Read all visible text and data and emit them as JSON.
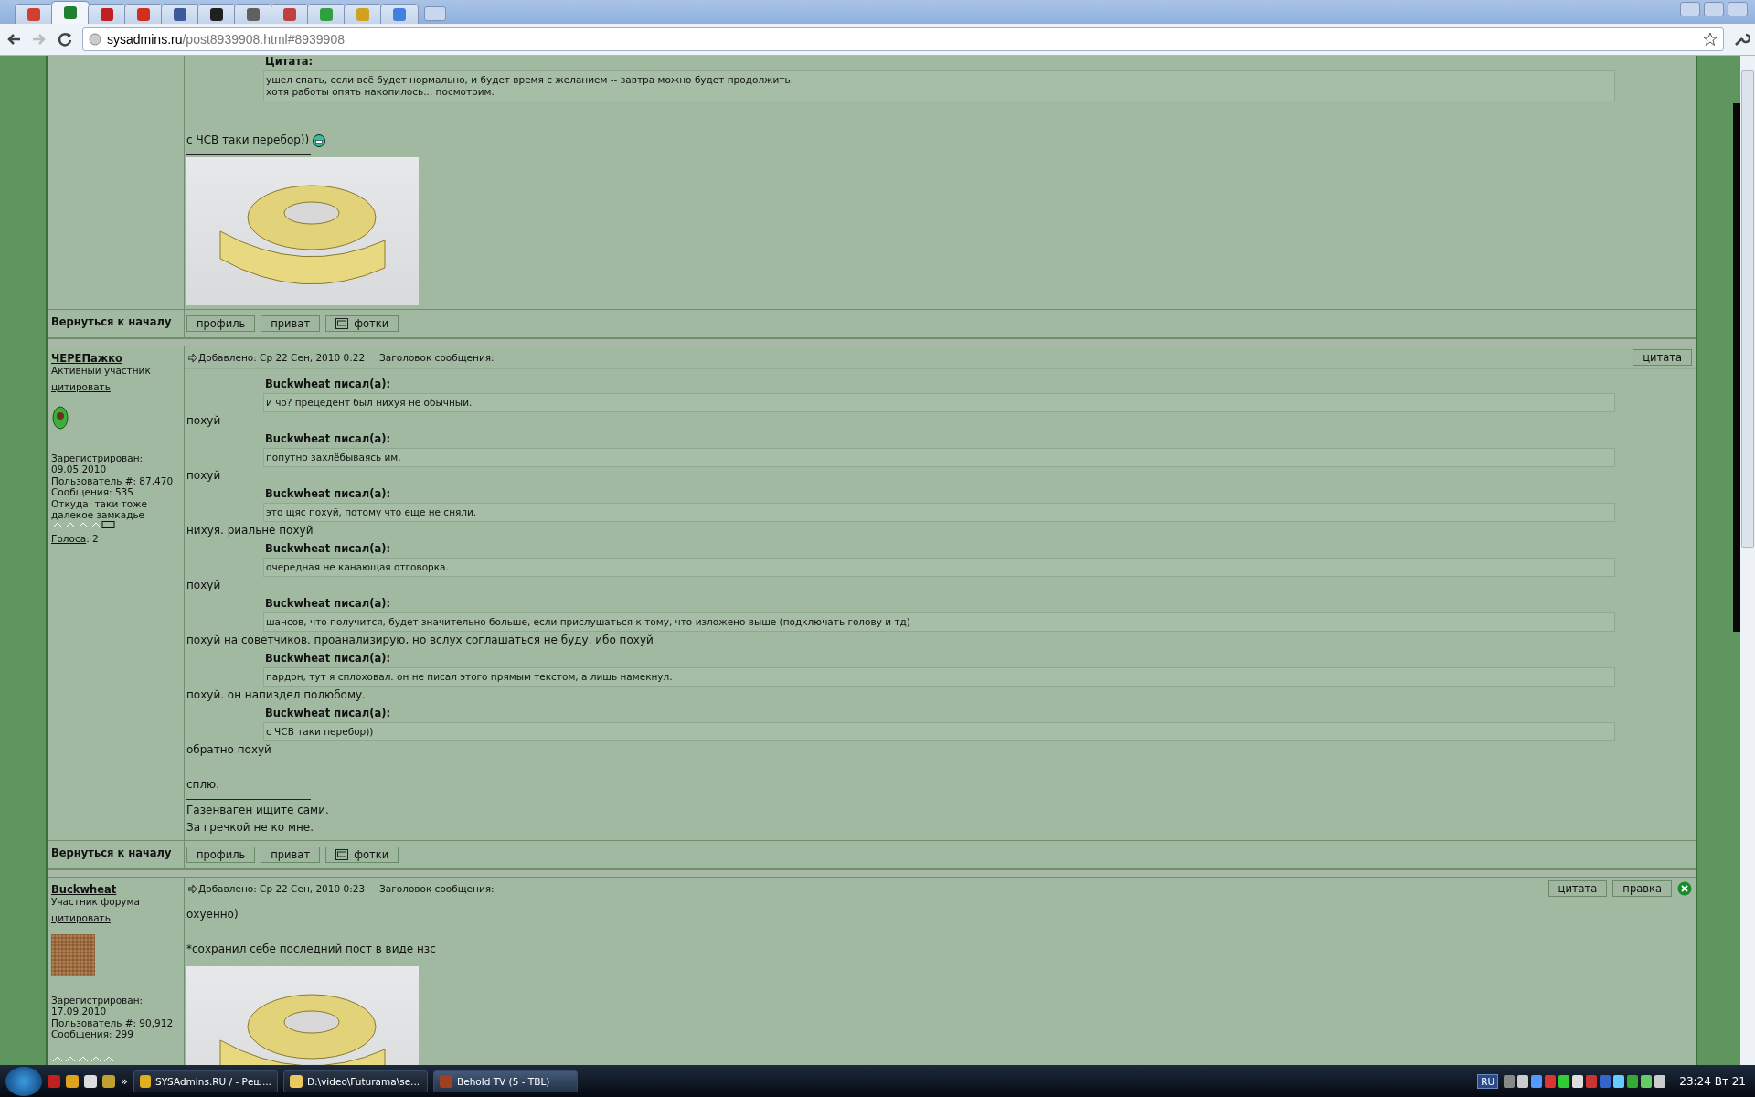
{
  "browser": {
    "tabs": [
      {
        "selected": false,
        "color": "#d04030"
      },
      {
        "selected": true,
        "color": "#208030"
      },
      {
        "selected": false,
        "color": "#c02020"
      },
      {
        "selected": false,
        "color": "#d03020"
      },
      {
        "selected": false,
        "color": "#3a5a9a"
      },
      {
        "selected": false,
        "color": "#202020"
      },
      {
        "selected": false,
        "color": "#606060"
      },
      {
        "selected": false,
        "color": "#c04040"
      },
      {
        "selected": false,
        "color": "#30a040"
      },
      {
        "selected": false,
        "color": "#d0a020"
      },
      {
        "selected": false,
        "color": "#4080e0"
      }
    ],
    "address": {
      "domain": "sysadmins.ru",
      "path": "/post8939908.html#8939908"
    }
  },
  "posts": [
    {
      "body": [
        {
          "kind": "quote",
          "header": "Цитата:",
          "lines": [
            "ушел спать, если всё будет нормально, и будет время с желанием -- завтра можно будет продолжить.",
            "хотя работы опять накопилось... посмотрим."
          ]
        },
        {
          "kind": "gap"
        },
        {
          "kind": "text",
          "text": "с ЧСВ таки перебор))",
          "smiley": true
        },
        {
          "kind": "signature_image"
        }
      ],
      "footer": {
        "back": "Вернуться к началу",
        "buttons": [
          "профиль",
          "приват",
          "фотки"
        ]
      }
    },
    {
      "author": {
        "name": "ЧЕРЕПажко",
        "rank": "Активный участник",
        "quote_link": "цитировать",
        "avatar": {
          "kind": "creature"
        },
        "stats": [
          "Зарегистрирован:",
          "09.05.2010",
          "Пользователь #: 87,470",
          "Сообщения: 535",
          "Откуда: таки тоже далекое замкадье"
        ],
        "votes_link": "Голоса",
        "votes": ": 2"
      },
      "posted": "Добавлено: Ср 22 Сен, 2010 0:22",
      "subject": "Заголовок сообщения:",
      "actions": [
        "цитата"
      ],
      "can_delete": false,
      "body": [
        {
          "kind": "quote",
          "header": "Buckwheat писал(а):",
          "lines": [
            "и чо? прецедент был нихуя не обычный."
          ]
        },
        {
          "kind": "text",
          "text": "похуй"
        },
        {
          "kind": "quote",
          "header": "Buckwheat писал(а):",
          "lines": [
            "попутно захлёбываясь им."
          ]
        },
        {
          "kind": "text",
          "text": "похуй"
        },
        {
          "kind": "quote",
          "header": "Buckwheat писал(а):",
          "lines": [
            "это щяс похуй, потому что еще не сняли."
          ]
        },
        {
          "kind": "text",
          "text": "нихуя. риальне похуй"
        },
        {
          "kind": "quote",
          "header": "Buckwheat писал(а):",
          "lines": [
            "очередная не канающая отговорка."
          ]
        },
        {
          "kind": "text",
          "text": "похуй"
        },
        {
          "kind": "quote",
          "header": "Buckwheat писал(а):",
          "lines": [
            "шансов, что получится, будет значительно больше, если прислушаться к тому, что изложено выше (подключать голову и тд)"
          ]
        },
        {
          "kind": "text",
          "text": "похуй на советчиков. проанализирую, но вслух соглашаться не буду. ибо похуй"
        },
        {
          "kind": "quote",
          "header": "Buckwheat писал(а):",
          "lines": [
            "пардон, тут я сплоховал. он не писал этого прямым текстом, а лишь намекнул."
          ]
        },
        {
          "kind": "text",
          "text": "похуй. он напиздел полюбому."
        },
        {
          "kind": "quote",
          "header": "Buckwheat писал(а):",
          "lines": [
            "с ЧСВ таки перебор))"
          ]
        },
        {
          "kind": "text",
          "text": "обратно похуй"
        },
        {
          "kind": "gap"
        },
        {
          "kind": "text",
          "text": "сплю."
        },
        {
          "kind": "signature_text",
          "lines": [
            "Газенваген ищите сами.",
            "За гречкой не ко мне."
          ]
        }
      ],
      "footer": {
        "back": "Вернуться к началу",
        "buttons": [
          "профиль",
          "приват",
          "фотки"
        ]
      }
    },
    {
      "author": {
        "name": "Buckwheat",
        "rank": "Участник форума",
        "quote_link": "цитировать",
        "avatar": {
          "kind": "buckwheat"
        },
        "stats": [
          "Зарегистрирован:",
          "17.09.2010",
          "Пользователь #: 90,912",
          "Сообщения: 299"
        ]
      },
      "posted": "Добавлено: Ср 22 Сен, 2010 0:23",
      "subject": "Заголовок сообщения:",
      "actions": [
        "цитата",
        "правка"
      ],
      "can_delete": true,
      "body": [
        {
          "kind": "text",
          "text": "охуенно)"
        },
        {
          "kind": "gap"
        },
        {
          "kind": "text",
          "text": "*сохранил себе последний пост в виде нзс"
        },
        {
          "kind": "signature_image"
        }
      ]
    }
  ],
  "taskbar": {
    "more": "»",
    "tasks": [
      {
        "label": "SYSAdmins.RU / - Реш...",
        "selected": false,
        "kind": "browser"
      },
      {
        "label": "D:\\video\\Futurama\\se...",
        "selected": false,
        "kind": "folder"
      },
      {
        "label": "Behold TV (5 - TBL)",
        "selected": true,
        "kind": "tv"
      }
    ],
    "language": "RU",
    "clock": "23:24 Вт 21"
  }
}
